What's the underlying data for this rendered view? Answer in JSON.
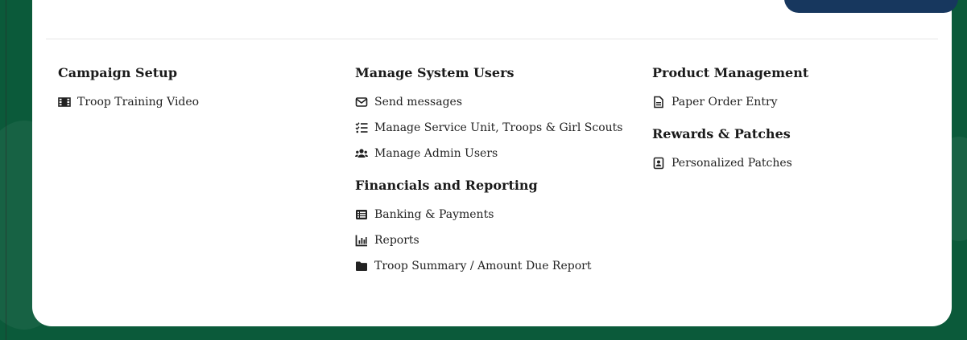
{
  "columns": [
    {
      "sections": [
        {
          "heading": "Campaign Setup",
          "items": [
            {
              "label": "Troop Training Video",
              "icon": "film-icon"
            }
          ]
        }
      ]
    },
    {
      "sections": [
        {
          "heading": "Manage System Users",
          "items": [
            {
              "label": "Send messages",
              "icon": "envelope-icon"
            },
            {
              "label": "Manage Service Unit, Troops & Girl Scouts",
              "icon": "checklist-icon"
            },
            {
              "label": "Manage Admin Users",
              "icon": "users-icon"
            }
          ]
        },
        {
          "heading": "Financials and Reporting",
          "items": [
            {
              "label": "Banking & Payments",
              "icon": "list-box-icon"
            },
            {
              "label": "Reports",
              "icon": "bar-chart-icon"
            },
            {
              "label": "Troop Summary / Amount Due Report",
              "icon": "folder-icon"
            }
          ]
        }
      ]
    },
    {
      "sections": [
        {
          "heading": "Product Management",
          "items": [
            {
              "label": "Paper Order Entry",
              "icon": "document-icon"
            }
          ]
        },
        {
          "heading": "Rewards & Patches",
          "items": [
            {
              "label": "Personalized Patches",
              "icon": "badge-icon"
            }
          ]
        }
      ]
    }
  ],
  "colors": {
    "background": "#0b5a3a",
    "card": "#ffffff",
    "top_button": "#17375e"
  }
}
